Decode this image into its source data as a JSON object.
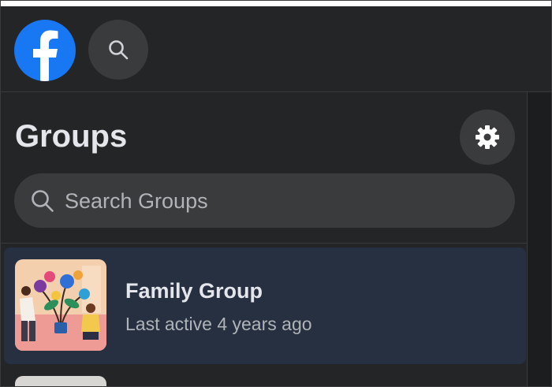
{
  "header": {
    "logo_icon": "facebook-logo-icon",
    "search_icon": "search-icon"
  },
  "groups_panel": {
    "title": "Groups",
    "settings_icon": "gear-icon",
    "search": {
      "placeholder": "Search Groups",
      "value": ""
    },
    "items": [
      {
        "name": "Family Group",
        "meta": "Last active 4 years ago",
        "thumbnail_icon": "group-illustration"
      }
    ]
  },
  "colors": {
    "background": "#18191a",
    "surface": "#242526",
    "accent": "#1877f2",
    "selected_item": "#263040",
    "primary_text": "#e4e6eb",
    "secondary_text": "#b0b3b8"
  }
}
